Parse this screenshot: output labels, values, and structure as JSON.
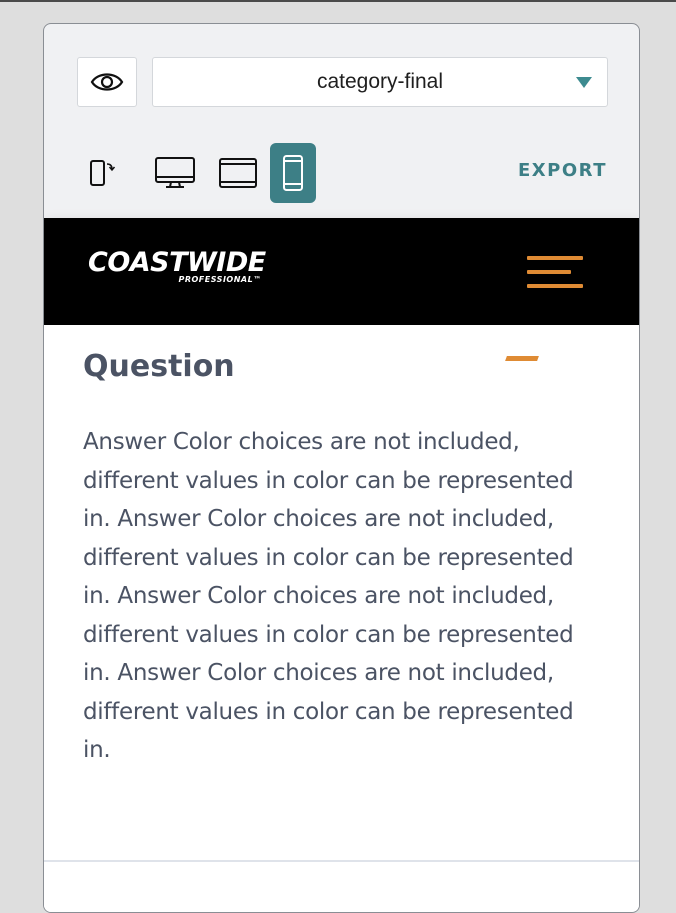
{
  "toolbar": {
    "preview_icon": "eye-icon",
    "template_select": {
      "value": "category-final"
    },
    "devices": [
      {
        "name": "rotate-device",
        "icon": "rotate-phone-icon",
        "active": false
      },
      {
        "name": "desktop",
        "icon": "desktop-icon",
        "active": false
      },
      {
        "name": "tablet",
        "icon": "tablet-icon",
        "active": false
      },
      {
        "name": "mobile",
        "icon": "mobile-icon",
        "active": true
      }
    ],
    "export_label": "EXPORT"
  },
  "site_header": {
    "logo_text": "COASTWIDE",
    "logo_subtext": "PROFESSIONAL™",
    "menu_icon": "hamburger-icon"
  },
  "faq": {
    "question": "Question",
    "answer": "Answer Color choices are not included, different values in color can be represented in. Answer Color choices are not included, different values in color can be represented in. Answer Color choices are not included, different values in color can be represented in. Answer Color choices are not included, different values in color can be represented in."
  },
  "colors": {
    "accent": "#3d7f86",
    "brand_orange": "#df8b34",
    "header_bg": "#000000",
    "text": "#4b5364"
  }
}
